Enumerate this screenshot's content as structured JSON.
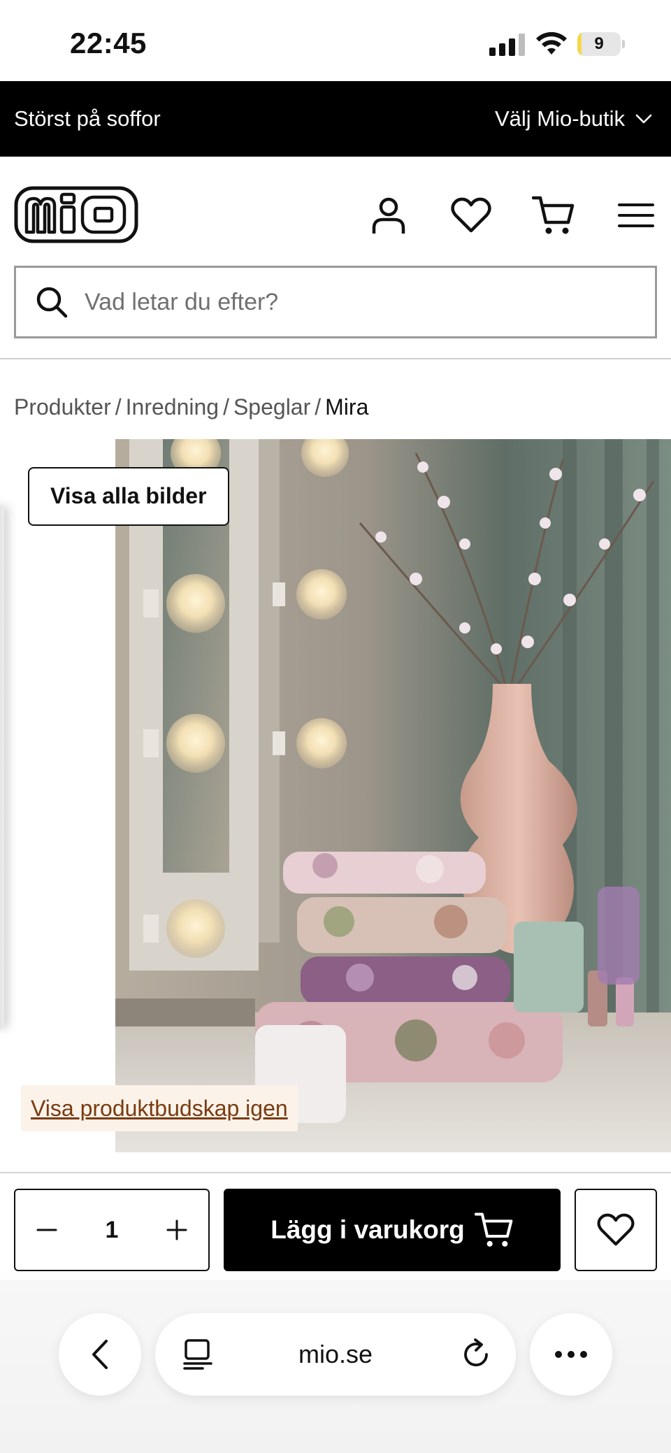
{
  "status_bar": {
    "time": "22:45",
    "battery_percent": "9",
    "battery_level": 0.09
  },
  "promo_bar": {
    "text": "Störst på soffor",
    "store_select_label": "Välj Mio-butik"
  },
  "header": {
    "logo_text": "mio",
    "icons": [
      "user-icon",
      "heart-icon",
      "cart-icon",
      "menu-icon"
    ]
  },
  "search": {
    "placeholder": "Vad letar du efter?"
  },
  "breadcrumb": {
    "items": [
      "Produkter",
      "Inredning",
      "Speglar"
    ],
    "separator": "/",
    "current": "Mira"
  },
  "gallery": {
    "view_all_label": "Visa alla bilder",
    "show_message_label": "Visa produktbudskap igen"
  },
  "buy_bar": {
    "quantity": "1",
    "add_to_cart_label": "Lägg i varukorg"
  },
  "browser": {
    "url": "mio.se"
  },
  "colors": {
    "promo_bg": "#000000",
    "primary_button": "#000000",
    "message_link": "#7a3b10",
    "message_bg": "#fbf3ea"
  }
}
